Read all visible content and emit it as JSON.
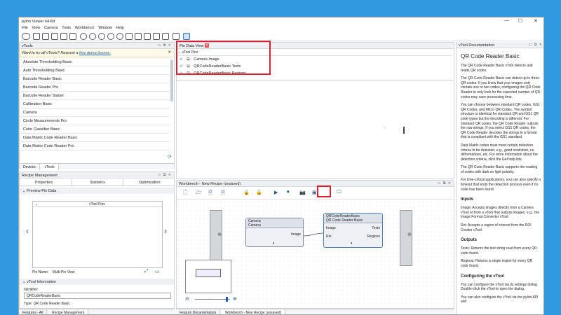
{
  "window": {
    "title": "pylon Viewer 64-Bit",
    "minimize": "—",
    "maximize": "☐",
    "close": "✕"
  },
  "menu": [
    "File",
    "View",
    "Camera",
    "Tools",
    "Workbench",
    "Window",
    "Help"
  ],
  "vtools": {
    "title": "vTools",
    "banner_text": "Want to try all vTools? Request a",
    "banner_link": "free demo license.",
    "items": [
      "Absolute Thresholding Basic",
      "Auto Thresholding Basic",
      "Barcode Reader Basic",
      "Barcode Reader Pro",
      "Barcode Reader Starter",
      "Calibration Basic",
      "Camera",
      "Circle Measurements Pro",
      "Color Classifier Basic",
      "Data Matrix Code Reader Basic",
      "Data Matrix Code Reader Pro"
    ],
    "tabs": [
      "Devices",
      "vTools"
    ]
  },
  "recipe": {
    "title": "Recipe Management",
    "tabs": [
      "Properties",
      "Statistics",
      "Optimization"
    ],
    "preview_section": "Preview Pin Data",
    "preview_dropdown": "vTool Pins",
    "pin_name_label": "Pin Name:",
    "pin_name_value": "Multi-Pin View",
    "info_section": "vTool Information",
    "identifier_label": "Identifier:",
    "identifier_value": "QRCodeReaderBasic",
    "type_text": "Type: QR Code Reader Basic"
  },
  "pin_view": {
    "tab": "Pin Data View 8",
    "header": "vTool Pins",
    "pins": [
      "Camera Image",
      "QRCodeReaderBasic Texts",
      "QRCodeReaderBasic Regions"
    ]
  },
  "workbench": {
    "title": "Workbench - New Recipe (unsaved)",
    "camera_node": {
      "title": "Camera",
      "subtitle": "Camera",
      "out_port": "Image"
    },
    "qr_node": {
      "title": "QRCodeReaderBasic",
      "subtitle": "QR Code Reader Basic",
      "in_ports": [
        "Image",
        "Roi"
      ],
      "out_ports": [
        "Texts",
        "Regions"
      ]
    }
  },
  "bottom_tabs_left": [
    "Features - All",
    "Recipe Management"
  ],
  "bottom_tabs_center": [
    "Feature Documentation",
    "Workbench - New Recipe (unsaved)"
  ],
  "doc": {
    "panel_title": "vTool Documentation",
    "heading": "QR Code Reader Basic",
    "p1": "The QR Code Reader Basic vTool detects and reads QR codes.",
    "p2": "The QR Code Reader Basic can detect up to three QR codes. If you know that your images only contain one or two codes, configuring the QR Code Reader to only look for the expected number of QR codes may save processing time.",
    "p3": "You can choose between standard QR codes, GS1 QR Codes, and Micro QR Codes. The symbol structure is identical for standard QR and GS1 QR code types but the decoding is different. For standard QR codes, the QR Code Reader outputs the raw strings. If you select GS1 QR codes, the QR Code Reader decodes the strings in a format that is compliant with the GS1 standard.",
    "p4": "Data Matrix codes must meet certain detection criteria to be detected, e.g., good resolution, no deformations, etc. For more information about the detection criteria, click the Get help link.",
    "p5": "The QR Code Reader Basic supports the reading of codes with dark on light polarity.",
    "p6": "For time-critical applications, you can also specify a timeout that ends the detection process even if no code has been found.",
    "inputs_heading": "Inputs",
    "input_image": "Image: Accepts images directly from a Camera vTool or from a vTool that outputs images, e.g., the Image Format Converter vTool.",
    "input_roi": "Roi: Accepts a region of interest from the ROI Creator vTool.",
    "outputs_heading": "Outputs",
    "output_texts": "Texts: Returns the text string read from every QR code found.",
    "output_regions": "Regions: Returns a single region for every QR code found.",
    "config_heading": "Configuring the vTool",
    "config_p1": "You can configure the vTool via its settings dialog. Double-click the vTool to open the dialog.",
    "config_p2": "You can also configure the vTool via the pylon API and"
  }
}
